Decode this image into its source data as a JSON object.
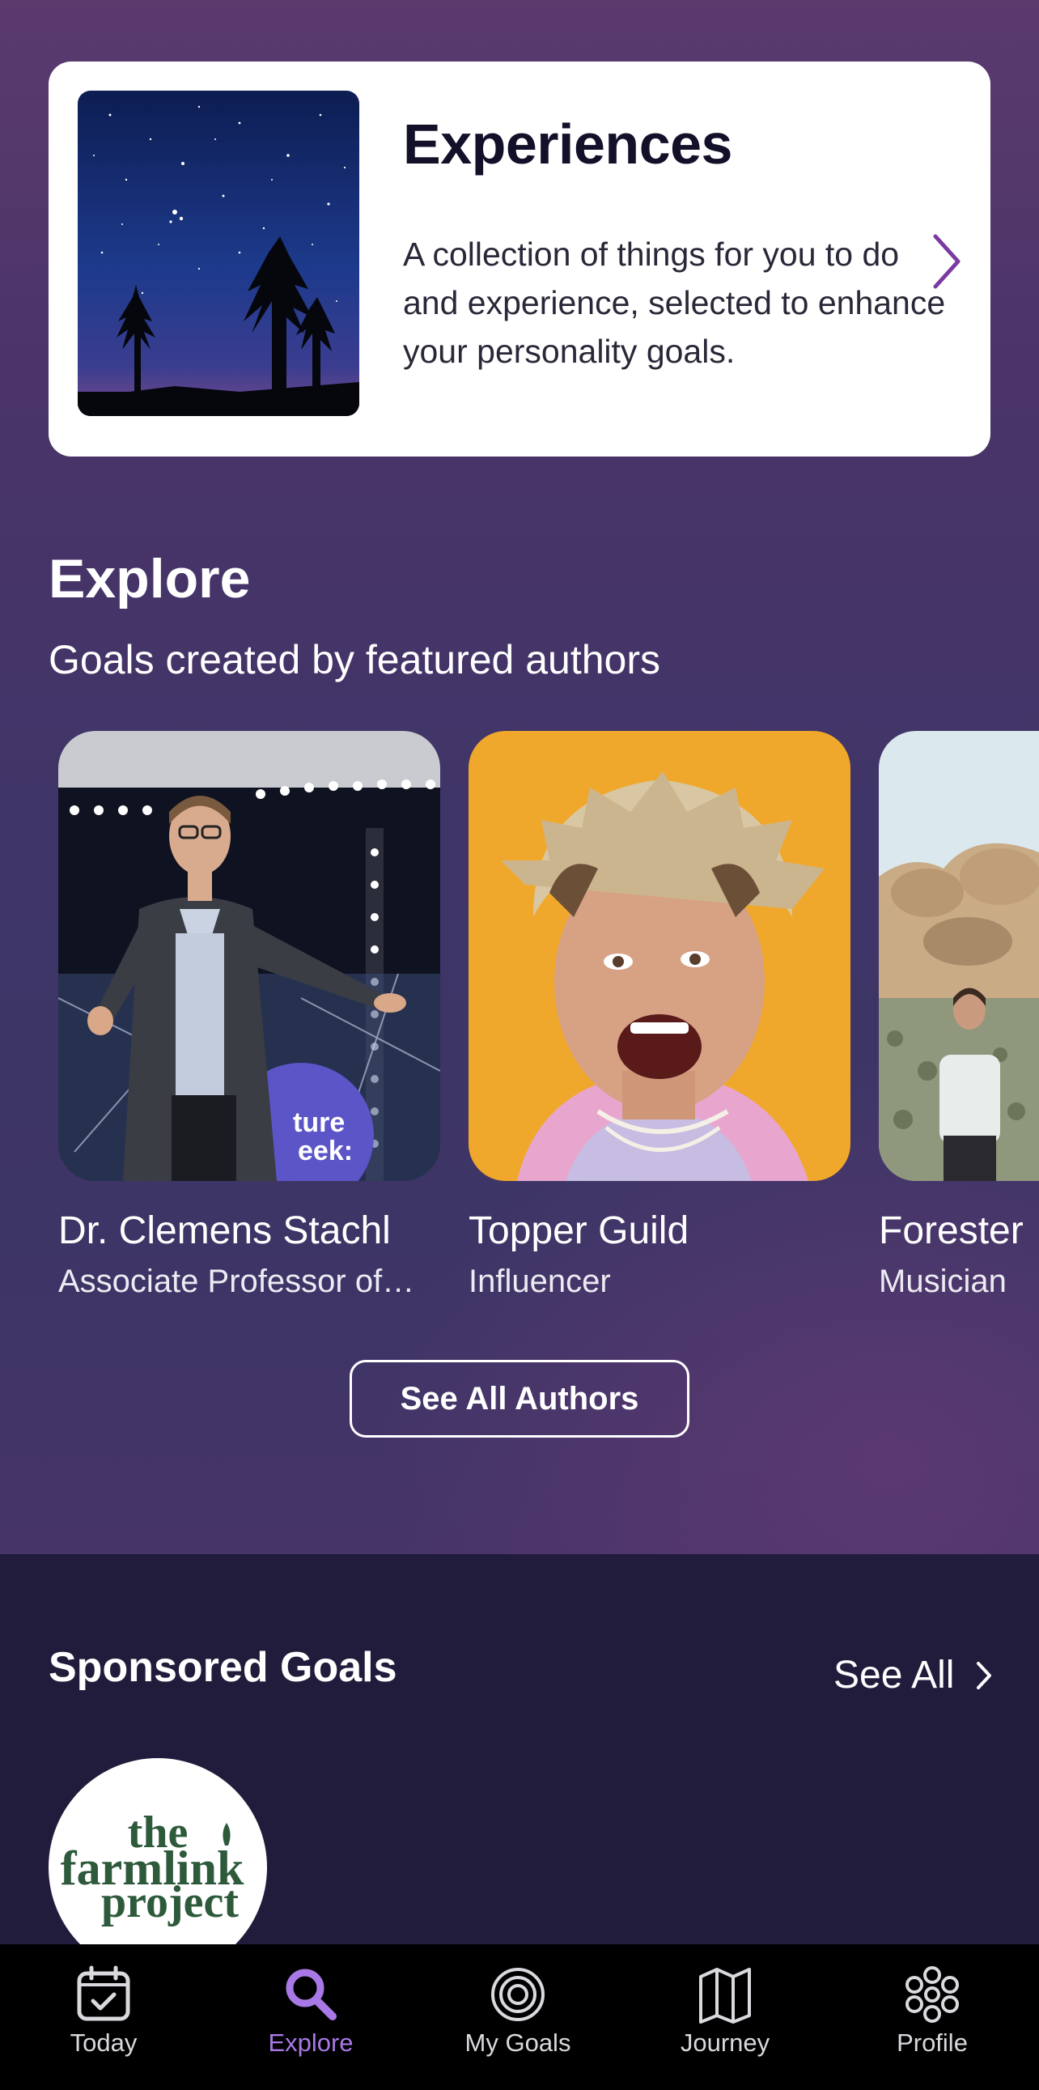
{
  "experiences": {
    "title": "Experiences",
    "description": "A collection of things for you to do and experience, selected to enhance your personality goals."
  },
  "explore": {
    "title": "Explore",
    "subtitle": "Goals created by featured authors",
    "authors": [
      {
        "name": "Dr. Clemens Stachl",
        "role": "Associate Professor of…"
      },
      {
        "name": "Topper Guild",
        "role": "Influencer"
      },
      {
        "name": "Forester",
        "role": "Musician"
      }
    ],
    "see_all_authors": "See All Authors"
  },
  "sponsored": {
    "title": "Sponsored Goals",
    "see_all": "See All",
    "logo_lines": [
      "the",
      "farmlink",
      "project"
    ]
  },
  "tabbar": {
    "tabs": [
      {
        "label": "Today",
        "icon": "calendar-check-icon"
      },
      {
        "label": "Explore",
        "icon": "search-icon"
      },
      {
        "label": "My Goals",
        "icon": "target-icon"
      },
      {
        "label": "Journey",
        "icon": "map-icon"
      },
      {
        "label": "Profile",
        "icon": "profile-flower-icon"
      }
    ],
    "active_index": 1
  },
  "colors": {
    "accent": "#a879e6",
    "chevron": "#7a3aa0",
    "logo_green": "#2e5a3c"
  }
}
